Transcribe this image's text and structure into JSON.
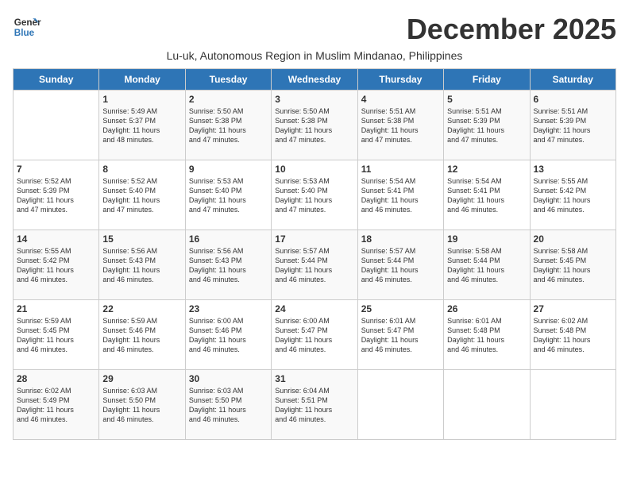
{
  "logo": {
    "line1": "General",
    "line2": "Blue"
  },
  "title": "December 2025",
  "subtitle": "Lu-uk, Autonomous Region in Muslim Mindanao, Philippines",
  "days_of_week": [
    "Sunday",
    "Monday",
    "Tuesday",
    "Wednesday",
    "Thursday",
    "Friday",
    "Saturday"
  ],
  "weeks": [
    [
      {
        "day": "",
        "sunrise": "",
        "sunset": "",
        "daylight": ""
      },
      {
        "day": "1",
        "sunrise": "Sunrise: 5:49 AM",
        "sunset": "Sunset: 5:37 PM",
        "daylight": "Daylight: 11 hours and 48 minutes."
      },
      {
        "day": "2",
        "sunrise": "Sunrise: 5:50 AM",
        "sunset": "Sunset: 5:38 PM",
        "daylight": "Daylight: 11 hours and 47 minutes."
      },
      {
        "day": "3",
        "sunrise": "Sunrise: 5:50 AM",
        "sunset": "Sunset: 5:38 PM",
        "daylight": "Daylight: 11 hours and 47 minutes."
      },
      {
        "day": "4",
        "sunrise": "Sunrise: 5:51 AM",
        "sunset": "Sunset: 5:38 PM",
        "daylight": "Daylight: 11 hours and 47 minutes."
      },
      {
        "day": "5",
        "sunrise": "Sunrise: 5:51 AM",
        "sunset": "Sunset: 5:39 PM",
        "daylight": "Daylight: 11 hours and 47 minutes."
      },
      {
        "day": "6",
        "sunrise": "Sunrise: 5:51 AM",
        "sunset": "Sunset: 5:39 PM",
        "daylight": "Daylight: 11 hours and 47 minutes."
      }
    ],
    [
      {
        "day": "7",
        "sunrise": "Sunrise: 5:52 AM",
        "sunset": "Sunset: 5:39 PM",
        "daylight": "Daylight: 11 hours and 47 minutes."
      },
      {
        "day": "8",
        "sunrise": "Sunrise: 5:52 AM",
        "sunset": "Sunset: 5:40 PM",
        "daylight": "Daylight: 11 hours and 47 minutes."
      },
      {
        "day": "9",
        "sunrise": "Sunrise: 5:53 AM",
        "sunset": "Sunset: 5:40 PM",
        "daylight": "Daylight: 11 hours and 47 minutes."
      },
      {
        "day": "10",
        "sunrise": "Sunrise: 5:53 AM",
        "sunset": "Sunset: 5:40 PM",
        "daylight": "Daylight: 11 hours and 47 minutes."
      },
      {
        "day": "11",
        "sunrise": "Sunrise: 5:54 AM",
        "sunset": "Sunset: 5:41 PM",
        "daylight": "Daylight: 11 hours and 46 minutes."
      },
      {
        "day": "12",
        "sunrise": "Sunrise: 5:54 AM",
        "sunset": "Sunset: 5:41 PM",
        "daylight": "Daylight: 11 hours and 46 minutes."
      },
      {
        "day": "13",
        "sunrise": "Sunrise: 5:55 AM",
        "sunset": "Sunset: 5:42 PM",
        "daylight": "Daylight: 11 hours and 46 minutes."
      }
    ],
    [
      {
        "day": "14",
        "sunrise": "Sunrise: 5:55 AM",
        "sunset": "Sunset: 5:42 PM",
        "daylight": "Daylight: 11 hours and 46 minutes."
      },
      {
        "day": "15",
        "sunrise": "Sunrise: 5:56 AM",
        "sunset": "Sunset: 5:43 PM",
        "daylight": "Daylight: 11 hours and 46 minutes."
      },
      {
        "day": "16",
        "sunrise": "Sunrise: 5:56 AM",
        "sunset": "Sunset: 5:43 PM",
        "daylight": "Daylight: 11 hours and 46 minutes."
      },
      {
        "day": "17",
        "sunrise": "Sunrise: 5:57 AM",
        "sunset": "Sunset: 5:44 PM",
        "daylight": "Daylight: 11 hours and 46 minutes."
      },
      {
        "day": "18",
        "sunrise": "Sunrise: 5:57 AM",
        "sunset": "Sunset: 5:44 PM",
        "daylight": "Daylight: 11 hours and 46 minutes."
      },
      {
        "day": "19",
        "sunrise": "Sunrise: 5:58 AM",
        "sunset": "Sunset: 5:44 PM",
        "daylight": "Daylight: 11 hours and 46 minutes."
      },
      {
        "day": "20",
        "sunrise": "Sunrise: 5:58 AM",
        "sunset": "Sunset: 5:45 PM",
        "daylight": "Daylight: 11 hours and 46 minutes."
      }
    ],
    [
      {
        "day": "21",
        "sunrise": "Sunrise: 5:59 AM",
        "sunset": "Sunset: 5:45 PM",
        "daylight": "Daylight: 11 hours and 46 minutes."
      },
      {
        "day": "22",
        "sunrise": "Sunrise: 5:59 AM",
        "sunset": "Sunset: 5:46 PM",
        "daylight": "Daylight: 11 hours and 46 minutes."
      },
      {
        "day": "23",
        "sunrise": "Sunrise: 6:00 AM",
        "sunset": "Sunset: 5:46 PM",
        "daylight": "Daylight: 11 hours and 46 minutes."
      },
      {
        "day": "24",
        "sunrise": "Sunrise: 6:00 AM",
        "sunset": "Sunset: 5:47 PM",
        "daylight": "Daylight: 11 hours and 46 minutes."
      },
      {
        "day": "25",
        "sunrise": "Sunrise: 6:01 AM",
        "sunset": "Sunset: 5:47 PM",
        "daylight": "Daylight: 11 hours and 46 minutes."
      },
      {
        "day": "26",
        "sunrise": "Sunrise: 6:01 AM",
        "sunset": "Sunset: 5:48 PM",
        "daylight": "Daylight: 11 hours and 46 minutes."
      },
      {
        "day": "27",
        "sunrise": "Sunrise: 6:02 AM",
        "sunset": "Sunset: 5:48 PM",
        "daylight": "Daylight: 11 hours and 46 minutes."
      }
    ],
    [
      {
        "day": "28",
        "sunrise": "Sunrise: 6:02 AM",
        "sunset": "Sunset: 5:49 PM",
        "daylight": "Daylight: 11 hours and 46 minutes."
      },
      {
        "day": "29",
        "sunrise": "Sunrise: 6:03 AM",
        "sunset": "Sunset: 5:50 PM",
        "daylight": "Daylight: 11 hours and 46 minutes."
      },
      {
        "day": "30",
        "sunrise": "Sunrise: 6:03 AM",
        "sunset": "Sunset: 5:50 PM",
        "daylight": "Daylight: 11 hours and 46 minutes."
      },
      {
        "day": "31",
        "sunrise": "Sunrise: 6:04 AM",
        "sunset": "Sunset: 5:51 PM",
        "daylight": "Daylight: 11 hours and 46 minutes."
      },
      {
        "day": "",
        "sunrise": "",
        "sunset": "",
        "daylight": ""
      },
      {
        "day": "",
        "sunrise": "",
        "sunset": "",
        "daylight": ""
      },
      {
        "day": "",
        "sunrise": "",
        "sunset": "",
        "daylight": ""
      }
    ]
  ]
}
